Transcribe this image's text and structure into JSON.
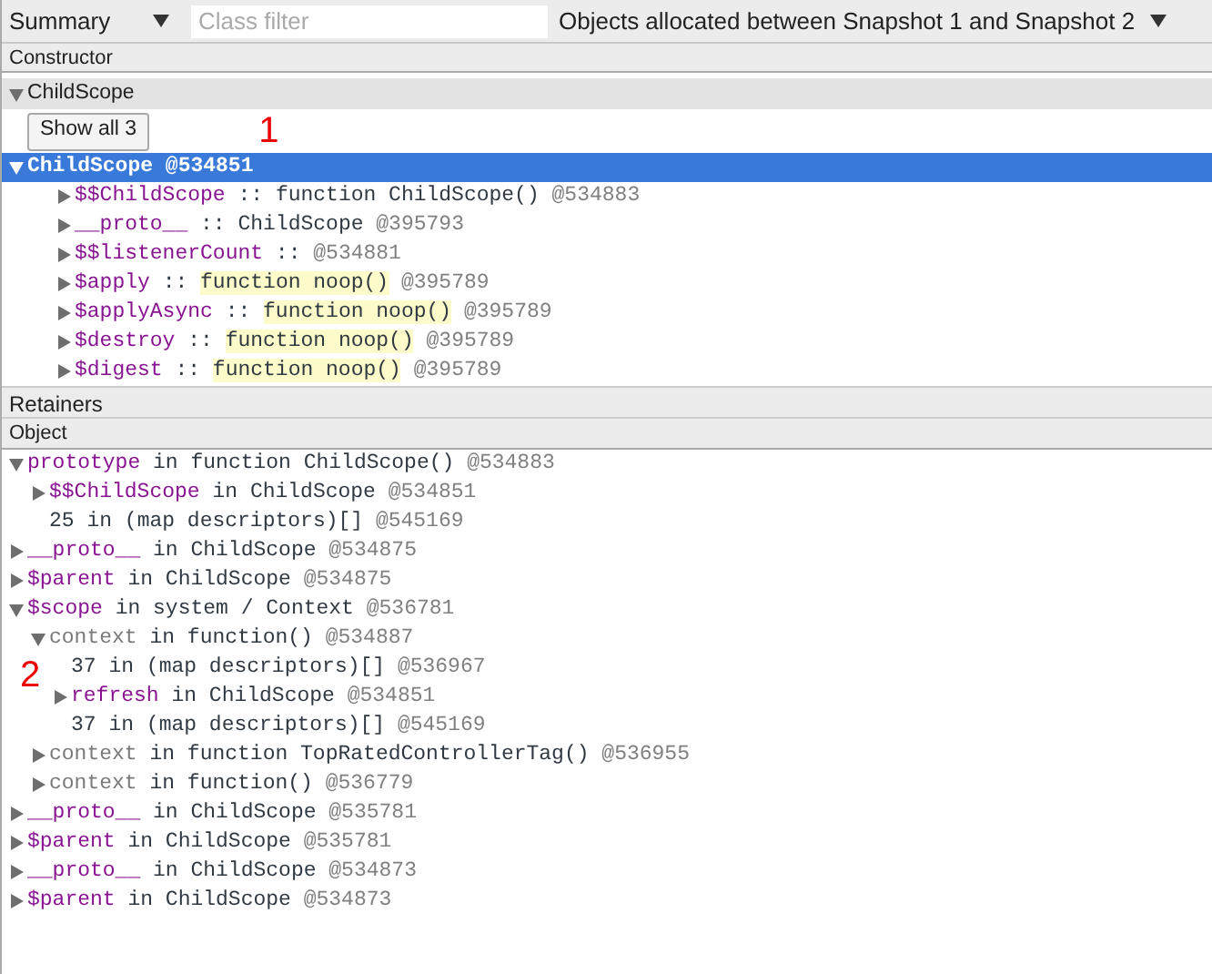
{
  "toolbar": {
    "view": "Summary",
    "filter_placeholder": "Class filter",
    "range": "Objects allocated between Snapshot 1 and Snapshot 2"
  },
  "constructors": {
    "header": "Constructor",
    "group": {
      "label": "ChildScope",
      "expanded": true
    },
    "show_all": "Show all 3",
    "annotation": "1",
    "selected": {
      "label": "ChildScope @534851",
      "expanded": true,
      "selected": true
    },
    "rows": [
      {
        "name": "$$ChildScope",
        "sep": " :: ",
        "value": "function ChildScope()",
        "highlight": false,
        "id": "@534883"
      },
      {
        "name": "__proto__",
        "sep": " :: ",
        "value": "ChildScope",
        "highlight": false,
        "id": "@395793"
      },
      {
        "name": "$$listenerCount",
        "sep": " :: ",
        "id": "@534881"
      },
      {
        "name": "$apply",
        "sep": " :: ",
        "value": "function noop()",
        "highlight": true,
        "id": "@395789"
      },
      {
        "name": "$applyAsync",
        "sep": " :: ",
        "value": "function noop()",
        "highlight": true,
        "id": "@395789"
      },
      {
        "name": "$destroy",
        "sep": " :: ",
        "value": "function noop()",
        "highlight": true,
        "id": "@395789"
      },
      {
        "name": "$digest",
        "sep": " :: ",
        "value": "function noop()",
        "highlight": true,
        "id": "@395789"
      }
    ]
  },
  "retainers": {
    "title": "Retainers",
    "header": "Object",
    "annotation": "2",
    "rows": [
      {
        "kind": "property",
        "has_children": true,
        "expanded": true,
        "name": "prototype",
        "sep": " in ",
        "value": "function ChildScope()",
        "id": "@534883",
        "children": [
          {
            "kind": "property",
            "has_children": true,
            "expanded": false,
            "name": "$$ChildScope",
            "sep": " in ",
            "value": "ChildScope",
            "id": "@534851"
          },
          {
            "kind": "index",
            "has_children": false,
            "expanded": false,
            "name": "25",
            "sep": " in ",
            "value": "(map descriptors)[]",
            "id": "@545169"
          }
        ]
      },
      {
        "kind": "property",
        "has_children": true,
        "expanded": false,
        "name": "__proto__",
        "sep": " in ",
        "value": "ChildScope",
        "id": "@534875"
      },
      {
        "kind": "property",
        "has_children": true,
        "expanded": false,
        "name": "$parent",
        "sep": " in ",
        "value": "ChildScope",
        "id": "@534875"
      },
      {
        "kind": "property",
        "has_children": true,
        "expanded": true,
        "name": "$scope",
        "sep": " in ",
        "value": "system / Context",
        "id": "@536781",
        "children": [
          {
            "kind": "internal",
            "has_children": true,
            "expanded": true,
            "name": "context",
            "sep": " in ",
            "value": "function()",
            "id": "@534887",
            "children": [
              {
                "kind": "index",
                "has_children": false,
                "expanded": false,
                "name": "37",
                "sep": " in ",
                "value": "(map descriptors)[]",
                "id": "@536967"
              },
              {
                "kind": "property",
                "has_children": true,
                "expanded": false,
                "name": "refresh",
                "sep": " in ",
                "value": "ChildScope",
                "id": "@534851"
              },
              {
                "kind": "index",
                "has_children": false,
                "expanded": false,
                "name": "37",
                "sep": " in ",
                "value": "(map descriptors)[]",
                "id": "@545169"
              }
            ]
          },
          {
            "kind": "internal",
            "has_children": true,
            "expanded": false,
            "name": "context",
            "sep": " in ",
            "value": "function TopRatedControllerTag()",
            "id": "@536955"
          },
          {
            "kind": "internal",
            "has_children": true,
            "expanded": false,
            "name": "context",
            "sep": " in ",
            "value": "function()",
            "id": "@536779"
          }
        ]
      },
      {
        "kind": "property",
        "has_children": true,
        "expanded": false,
        "name": "__proto__",
        "sep": " in ",
        "value": "ChildScope",
        "id": "@535781"
      },
      {
        "kind": "property",
        "has_children": true,
        "expanded": false,
        "name": "$parent",
        "sep": " in ",
        "value": "ChildScope",
        "id": "@535781"
      },
      {
        "kind": "property",
        "has_children": true,
        "expanded": false,
        "name": "__proto__",
        "sep": " in ",
        "value": "ChildScope",
        "id": "@534873"
      },
      {
        "kind": "property",
        "has_children": true,
        "expanded": false,
        "name": "$parent",
        "sep": " in ",
        "value": "ChildScope",
        "id": "@534873"
      }
    ]
  }
}
